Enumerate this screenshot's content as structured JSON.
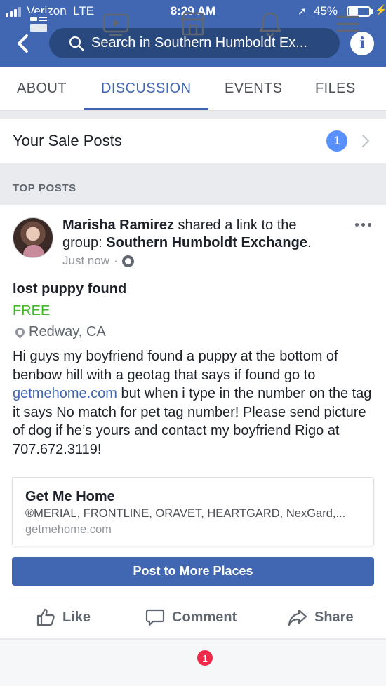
{
  "status_bar": {
    "carrier": "Verizon",
    "network": "LTE",
    "time": "8:29 AM",
    "battery_percent": "45%",
    "battery_level": 0.45
  },
  "nav": {
    "search_placeholder": "Search in Southern Humboldt Ex...",
    "info_label": "i"
  },
  "tabs": [
    {
      "label": "ABOUT",
      "active": false
    },
    {
      "label": "DISCUSSION",
      "active": true
    },
    {
      "label": "EVENTS",
      "active": false
    },
    {
      "label": "FILES",
      "active": false
    }
  ],
  "sale_posts": {
    "label": "Your Sale Posts",
    "count": "1"
  },
  "section_header": "TOP POSTS",
  "post": {
    "author": "Marisha Ramirez",
    "action_text": "shared a link to the group:",
    "group_name": "Southern Humboldt Exchange",
    "headline_end": ".",
    "timestamp": "Just now",
    "meta_separator": "·",
    "title": "lost puppy found",
    "price": "FREE",
    "location": "Redway, CA",
    "body_part1": "Hi guys my boyfriend found a puppy at the bottom of benbow hill with a geotag that says if found go to ",
    "body_link": "getmehome.com",
    "body_part2": " but when i type in the number on the tag it says No match for pet tag number! Please send picture of dog if he’s yours and contact my boyfriend Rigo at 707.672.3119!",
    "link_card": {
      "title": "Get Me Home",
      "description": "®MERIAL, FRONTLINE, ORAVET, HEARTGARD, NexGard,...",
      "domain": "getmehome.com"
    },
    "cta_label": "Post to More Places",
    "actions": {
      "like": "Like",
      "comment": "Comment",
      "share": "Share"
    }
  },
  "bottom_nav": {
    "marketplace_badge": "1"
  },
  "colors": {
    "brand_blue": "#4267b2",
    "free_green": "#42b72a",
    "badge_red": "#f02849",
    "count_badge_blue": "#5890ff"
  }
}
